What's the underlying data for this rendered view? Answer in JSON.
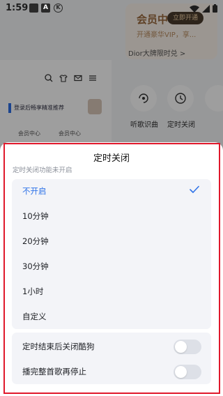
{
  "status_bar": {
    "time": "1:59",
    "icons": [
      "image-notification-icon",
      "a-notification-icon",
      "k-notification-icon",
      "wifi-icon",
      "signal-icon",
      "battery-icon"
    ]
  },
  "background": {
    "vip_title": "会员中",
    "vip_button": "立即开通",
    "vip_subtitle": "开通豪华VIP，享...",
    "dior_text": "Dior大牌限时兑 >",
    "login_banner": "登录后畅享精准推荐",
    "member_center_1": "会员中心",
    "member_center_2": "会员中心",
    "recognize_label": "听歌识曲",
    "timer_label": "定时关闭"
  },
  "sheet": {
    "title": "定时关闭",
    "subtitle": "定时关闭功能未开启",
    "options": [
      {
        "label": "不开启",
        "selected": true
      },
      {
        "label": "10分钟",
        "selected": false
      },
      {
        "label": "20分钟",
        "selected": false
      },
      {
        "label": "30分钟",
        "selected": false
      },
      {
        "label": "1小时",
        "selected": false
      },
      {
        "label": "自定义",
        "selected": false
      }
    ],
    "toggles": [
      {
        "label": "定时结束后关闭酷狗",
        "on": false
      },
      {
        "label": "播完整首歌再停止",
        "on": false
      }
    ]
  },
  "colors": {
    "accent": "#2f73e8",
    "highlight_frame": "#e0182b",
    "card_bg": "#f3f4f8"
  }
}
